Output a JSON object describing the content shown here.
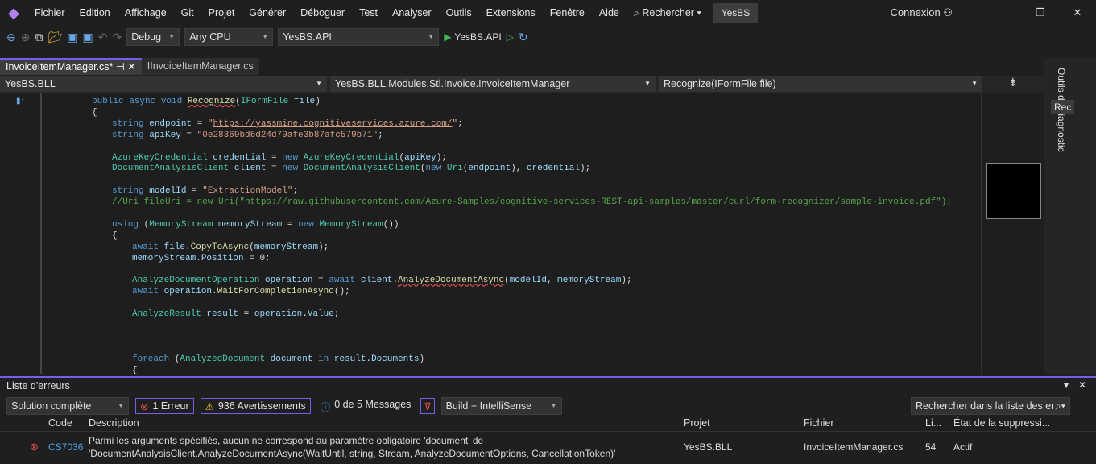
{
  "menu": [
    "Fichier",
    "Edition",
    "Affichage",
    "Git",
    "Projet",
    "Générer",
    "Déboguer",
    "Test",
    "Analyser",
    "Outils",
    "Extensions",
    "Fenêtre",
    "Aide"
  ],
  "search_label": "Rechercher",
  "solution_name": "YesBS",
  "account": "Connexion",
  "toolbar": {
    "config": "Debug",
    "platform": "Any CPU",
    "startup": "YesBS.API",
    "run_label": "YesBS.API"
  },
  "tabs": [
    {
      "label": "InvoiceItemManager.cs*",
      "active": true
    },
    {
      "label": "IInvoiceItemManager.cs",
      "active": false
    }
  ],
  "navbar": {
    "project": "YesBS.BLL",
    "type": "YesBS.BLL.Modules.Stl.Invoice.InvoiceItemManager",
    "member": "Recognize(IFormFile file)"
  },
  "side_panel": {
    "title": "Outils de diagnostic",
    "tab": "Rec"
  },
  "code": [
    {
      "t": [
        [
          "kw",
          "public async void "
        ],
        [
          "me sq",
          "Recognize"
        ],
        [
          "",
          "("
        ],
        [
          "ty",
          "IFormFile"
        ],
        [
          "va",
          " file"
        ],
        [
          "",
          ")"
        ]
      ],
      "i": 0
    },
    {
      "t": [
        [
          "",
          "{"
        ]
      ],
      "i": 0
    },
    {
      "t": [
        [
          "kw",
          "string "
        ],
        [
          "va",
          "endpoint"
        ],
        [
          "",
          " = "
        ],
        [
          "st",
          "\""
        ],
        [
          "st url",
          "https://yassmine.cognitiveservices.azure.com/"
        ],
        [
          "st",
          "\""
        ],
        [
          "",
          ";"
        ]
      ],
      "i": 1
    },
    {
      "t": [
        [
          "kw",
          "string "
        ],
        [
          "va",
          "apiKey"
        ],
        [
          "",
          " = "
        ],
        [
          "st",
          "\"0e28369bd6d24d79afe3b87afc579b71\""
        ],
        [
          "",
          ";"
        ]
      ],
      "i": 1
    },
    {
      "t": [],
      "i": 0
    },
    {
      "t": [
        [
          "ty",
          "AzureKeyCredential "
        ],
        [
          "va",
          "credential"
        ],
        [
          "",
          " = "
        ],
        [
          "kw",
          "new "
        ],
        [
          "ty",
          "AzureKeyCredential"
        ],
        [
          "",
          "("
        ],
        [
          "va",
          "apiKey"
        ],
        [
          "",
          ");"
        ]
      ],
      "i": 1
    },
    {
      "t": [
        [
          "ty",
          "DocumentAnalysisClient "
        ],
        [
          "va",
          "client"
        ],
        [
          "",
          " = "
        ],
        [
          "kw",
          "new "
        ],
        [
          "ty",
          "DocumentAnalysisClient"
        ],
        [
          "",
          "("
        ],
        [
          "kw",
          "new "
        ],
        [
          "ty",
          "Uri"
        ],
        [
          "",
          "("
        ],
        [
          "va",
          "endpoint"
        ],
        [
          "",
          "), "
        ],
        [
          "va",
          "credential"
        ],
        [
          "",
          ");"
        ]
      ],
      "i": 1
    },
    {
      "t": [],
      "i": 0
    },
    {
      "t": [
        [
          "kw",
          "string "
        ],
        [
          "va",
          "modelId"
        ],
        [
          "",
          " = "
        ],
        [
          "st",
          "\"ExtractionModel\""
        ],
        [
          "",
          ";"
        ]
      ],
      "i": 1
    },
    {
      "t": [
        [
          "cm",
          "//Uri fileUri = new Uri(\""
        ],
        [
          "cm url",
          "https://raw.githubusercontent.com/Azure-Samples/cognitive-services-REST-api-samples/master/curl/form-recognizer/sample-invoice.pdf"
        ],
        [
          "cm",
          "\");"
        ]
      ],
      "i": 1
    },
    {
      "t": [],
      "i": 0
    },
    {
      "t": [
        [
          "kw",
          "using "
        ],
        [
          "",
          "("
        ],
        [
          "ty",
          "MemoryStream "
        ],
        [
          "va",
          "memoryStream"
        ],
        [
          "",
          " = "
        ],
        [
          "kw",
          "new "
        ],
        [
          "ty",
          "MemoryStream"
        ],
        [
          "",
          "())"
        ]
      ],
      "i": 1
    },
    {
      "t": [
        [
          "",
          "{"
        ]
      ],
      "i": 1
    },
    {
      "t": [
        [
          "kw",
          "await "
        ],
        [
          "va",
          "file"
        ],
        [
          "",
          "."
        ],
        [
          "me",
          "CopyToAsync"
        ],
        [
          "",
          "("
        ],
        [
          "va",
          "memoryStream"
        ],
        [
          "",
          ");"
        ]
      ],
      "i": 2
    },
    {
      "t": [
        [
          "va",
          "memoryStream"
        ],
        [
          "",
          "."
        ],
        [
          "va",
          "Position"
        ],
        [
          "",
          " = "
        ],
        [
          "",
          "0;"
        ]
      ],
      "i": 2
    },
    {
      "t": [],
      "i": 0
    },
    {
      "t": [
        [
          "ty",
          "AnalyzeDocumentOperation "
        ],
        [
          "va",
          "operation"
        ],
        [
          "",
          " = "
        ],
        [
          "kw",
          "await "
        ],
        [
          "va",
          "client"
        ],
        [
          "",
          "."
        ],
        [
          "me sq",
          "AnalyzeDocumentAsync"
        ],
        [
          "",
          "("
        ],
        [
          "va",
          "modelId"
        ],
        [
          "",
          ", "
        ],
        [
          "va",
          "memoryStream"
        ],
        [
          "",
          ");"
        ]
      ],
      "i": 2
    },
    {
      "t": [
        [
          "kw",
          "await "
        ],
        [
          "va",
          "operation"
        ],
        [
          "",
          "."
        ],
        [
          "me",
          "WaitForCompletionAsync"
        ],
        [
          "",
          "();"
        ]
      ],
      "i": 2
    },
    {
      "t": [],
      "i": 0
    },
    {
      "t": [
        [
          "ty",
          "AnalyzeResult "
        ],
        [
          "va",
          "result"
        ],
        [
          "",
          " = "
        ],
        [
          "va",
          "operation"
        ],
        [
          "",
          "."
        ],
        [
          "va",
          "Value"
        ],
        [
          "",
          ";"
        ]
      ],
      "i": 2
    },
    {
      "t": [],
      "i": 0
    },
    {
      "t": [],
      "i": 0
    },
    {
      "t": [],
      "i": 0
    },
    {
      "t": [
        [
          "kw",
          "foreach "
        ],
        [
          "",
          "("
        ],
        [
          "ty",
          "AnalyzedDocument "
        ],
        [
          "va",
          "document"
        ],
        [
          "kw",
          " in "
        ],
        [
          "va",
          "result"
        ],
        [
          "",
          "."
        ],
        [
          "va",
          "Documents"
        ],
        [
          "",
          ")"
        ]
      ],
      "i": 2
    },
    {
      "t": [
        [
          "",
          "{"
        ]
      ],
      "i": 2
    }
  ],
  "error_list": {
    "title": "Liste d'erreurs",
    "scope": "Solution complète",
    "errors": "1 Erreur",
    "warnings": "936 Avertissements",
    "messages": "0 de 5 Messages",
    "source": "Build + IntelliSense",
    "search_placeholder": "Rechercher dans la liste des er",
    "columns": [
      "Code",
      "Description",
      "Projet",
      "Fichier",
      "Li...",
      "État de la suppressi..."
    ],
    "rows": [
      {
        "code": "CS7036",
        "desc1": "Parmi les arguments spécifiés, aucun ne correspond au paramètre obligatoire 'document' de",
        "desc2": "'DocumentAnalysisClient.AnalyzeDocumentAsync(WaitUntil, string, Stream, AnalyzeDocumentOptions, CancellationToken)'",
        "project": "YesBS.BLL",
        "file": "InvoiceItemManager.cs",
        "line": "54",
        "state": "Actif"
      }
    ]
  },
  "colors": {
    "accent": "#7160e8",
    "error": "#e05050"
  }
}
